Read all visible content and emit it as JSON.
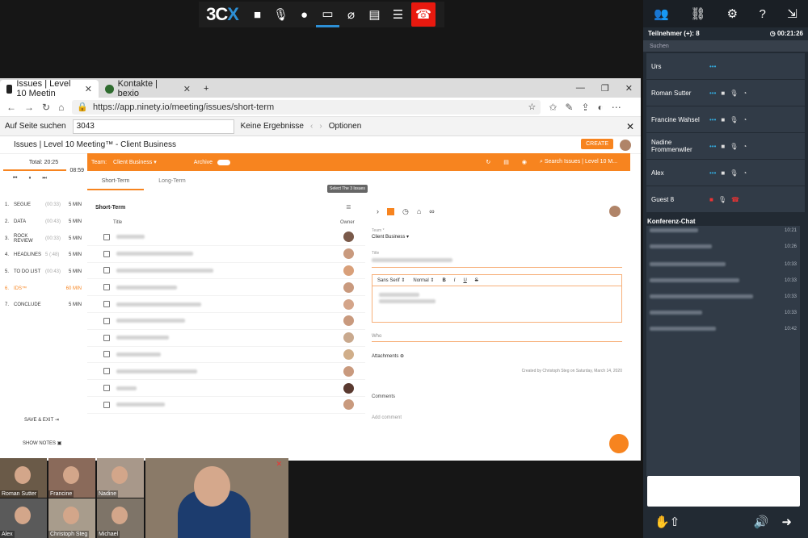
{
  "toolbar3cx": {
    "logo_a": "3C",
    "logo_b": "X",
    "icons": [
      "video-camera-icon",
      "microphone-icon",
      "record-icon",
      "screen-share-icon",
      "attachment-icon",
      "whiteboard-icon",
      "document-icon"
    ],
    "hangup": "hang-up-icon"
  },
  "browser": {
    "tabs": [
      {
        "label": "Issues | Level 10 Meetin",
        "active": true
      },
      {
        "label": "Kontakte | bexio",
        "active": false
      }
    ],
    "url": "https://app.ninety.io/meeting/issues/short-term",
    "find": {
      "label": "Auf Seite suchen",
      "value": "3043",
      "result": "Keine Ergebnisse",
      "options": "Optionen"
    }
  },
  "app": {
    "title": "Issues | Level 10 Meeting™ - Client Business",
    "create": "CREATE",
    "timer": {
      "total_label": "Total:",
      "total": "20:25",
      "elapsed": "08:59"
    },
    "agenda": [
      {
        "n": "1.",
        "label": "SEGUE",
        "d": "(00:33)",
        "m": "5 MIN"
      },
      {
        "n": "2.",
        "label": "DATA",
        "d": "(00:43)",
        "m": "5 MIN"
      },
      {
        "n": "3.",
        "label": "ROCK REVIEW",
        "d": "(00:33)",
        "m": "5 MIN"
      },
      {
        "n": "4.",
        "label": "HEADLINES",
        "d": "5 (:48)",
        "m": "5 MIN"
      },
      {
        "n": "5.",
        "label": "TO DO LIST",
        "d": "(00:43)",
        "m": "5 MIN"
      },
      {
        "n": "6.",
        "label": "IDS™",
        "d": "",
        "m": "60 MIN"
      },
      {
        "n": "7.",
        "label": "CONCLUDE",
        "d": "",
        "m": "5 MIN"
      }
    ],
    "save_exit": "SAVE & EXIT",
    "show_notes": "SHOW NOTES",
    "orange_bar": {
      "team_label": "Team:",
      "team": "Client Business",
      "archive": "Archive",
      "search": "Search Issues | Level 10 M..."
    },
    "list_tabs": [
      "Short-Term",
      "Long-Term"
    ],
    "list": {
      "heading": "Short-Term",
      "col_title": "Title",
      "col_owner": "Owner",
      "tooltip": "Select The 3 Issues",
      "rows": 11
    },
    "detail": {
      "team_label": "Team *",
      "team": "Client Business",
      "title_label": "Title",
      "font": "Sans Serif",
      "size": "Normal",
      "who": "Who",
      "attachments": "Attachments",
      "created": "Created by Christoph Steg on Saturday, March 14, 2020",
      "comments": "Comments",
      "add_comment": "Add comment"
    }
  },
  "call": {
    "participants_label": "Teilnehmer (+): 8",
    "duration": "00:21:26",
    "search": "Suchen",
    "participants": [
      {
        "name": "Urs"
      },
      {
        "name": "Roman Sutter"
      },
      {
        "name": "Francine Wahsel"
      },
      {
        "name": "Nadine Frommenwiler"
      },
      {
        "name": "Alex"
      },
      {
        "name": "Guest 8"
      }
    ],
    "chat_title": "Konferenz-Chat",
    "chat_times": [
      "10:21",
      "10:26",
      "10:33",
      "10:33",
      "10:33",
      "10:33",
      "10:42"
    ]
  },
  "videos": [
    {
      "label": "Roman Sutter"
    },
    {
      "label": "Francine"
    },
    {
      "label": "Nadine"
    },
    {
      "label": "Alex"
    },
    {
      "label": "Christoph Steg"
    },
    {
      "label": "Michael"
    }
  ]
}
